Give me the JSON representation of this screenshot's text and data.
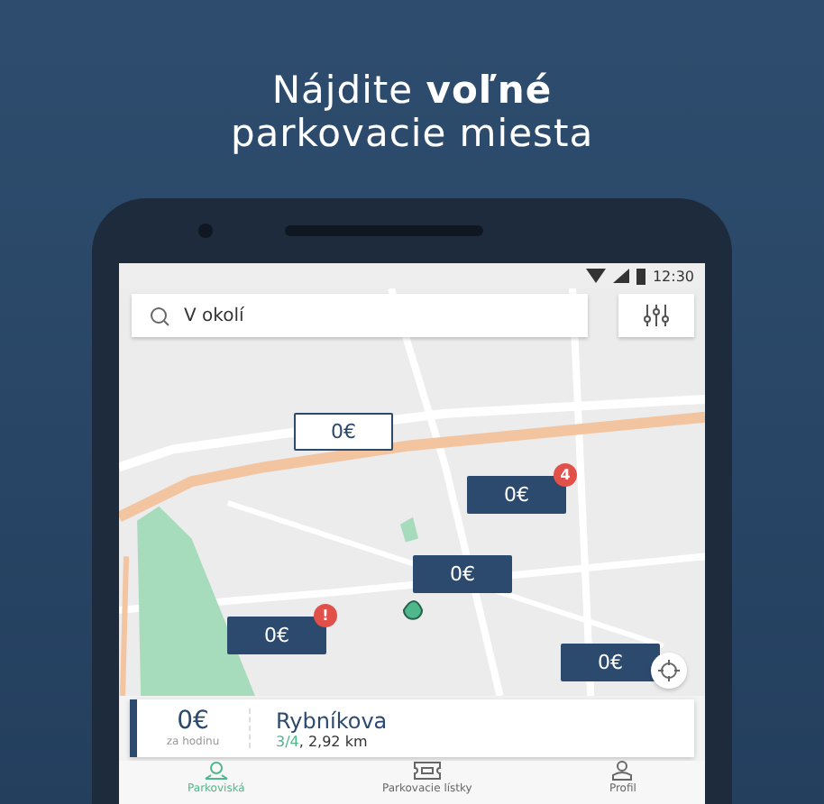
{
  "headline": {
    "line_1": "Nájdite **voľné**",
    "line_2": "parkovacie miesta"
  },
  "status_bar": {
    "time": "12:30"
  },
  "search": {
    "value": "V okolí"
  },
  "map": {
    "kind": "picture",
    "markers": [
      {
        "label": "0€",
        "selected": true
      },
      {
        "label": "0€",
        "selected": false,
        "badge": "4"
      },
      {
        "label": "0€",
        "selected": false
      },
      {
        "label": "0€",
        "selected": false,
        "badge": "!"
      },
      {
        "label": "0€",
        "selected": false
      }
    ]
  },
  "parking_card": {
    "price": "0€",
    "price_unit": "za hodinu",
    "name": "Rybníkova",
    "occupancy": "3/4",
    "distance": ", 2,92 km"
  },
  "bottom_nav": [
    {
      "label": "Parkoviská",
      "kind": "pin",
      "selected": true
    },
    {
      "label": "Parkovacie lístky",
      "kind": "ticket",
      "selected": false
    },
    {
      "label": "Profil",
      "kind": "profile",
      "selected": false
    }
  ]
}
